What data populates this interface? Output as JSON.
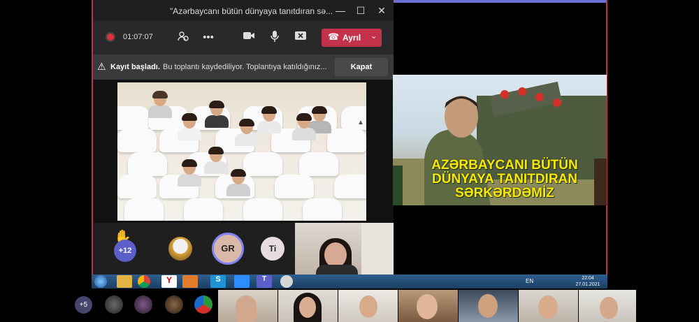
{
  "window": {
    "title": "\"Azərbaycanı bütün dünyaya tanıtdıran sə...",
    "minimize_icon": "minimize-icon",
    "maximize_icon": "maximize-icon",
    "close_icon": "close-icon"
  },
  "toolbar": {
    "timer": "01:07:07",
    "leave_label": "Ayrıl"
  },
  "banner": {
    "bold_text": "Kayıt başladı.",
    "message": "Bu toplantı kaydediliyor. Toplantıya katıldığınız...",
    "close_label": "Kapat"
  },
  "participants": {
    "hand_raised_count": "+12",
    "gr_initials": "GR",
    "ti_initials": "Ti"
  },
  "slide": {
    "text": "AZƏRBAYCANI BÜTÜN DÜNYAYA TANITDIRAN SƏRKƏRDƏMİZ"
  },
  "taskbar": {
    "language": "EN",
    "time": "22:04",
    "date": "27.01.2021"
  },
  "strip": {
    "overflow_count": "+5"
  },
  "colors": {
    "leave_red": "#c4314b",
    "teams_purple": "#5b5fc7",
    "slide_text_yellow": "#ffe600"
  }
}
